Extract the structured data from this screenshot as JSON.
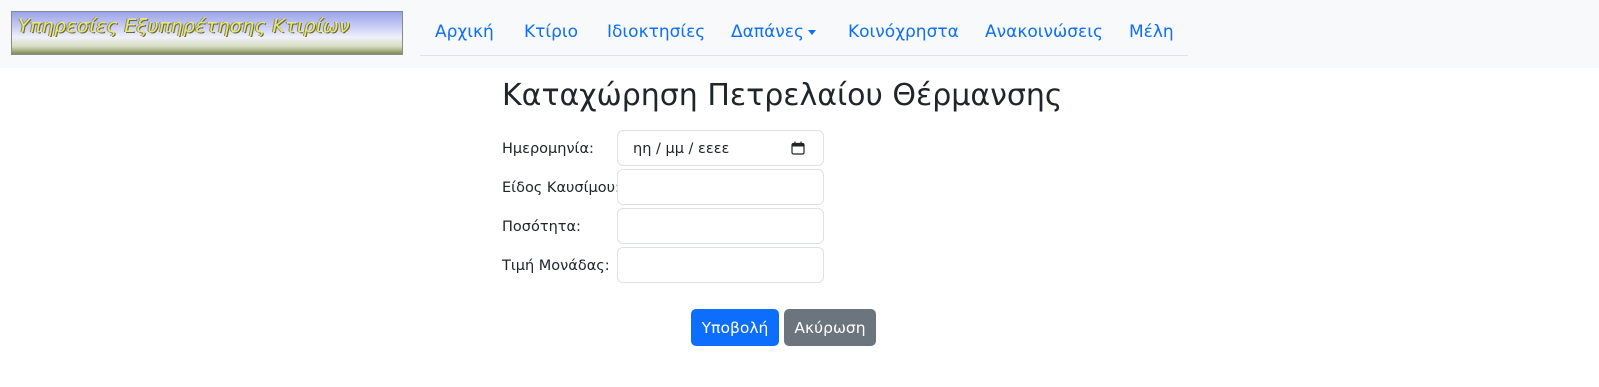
{
  "header": {
    "logo_text": "Υπηρεσίες Εξυπηρέτησης Κτιρίων",
    "nav": [
      {
        "label": "Αρχική"
      },
      {
        "label": "Κτίριο"
      },
      {
        "label": "Ιδιοκτησίες"
      },
      {
        "label": "Δαπάνες",
        "dropdown": true
      },
      {
        "label": "Κοινόχρηστα"
      },
      {
        "label": "Ανακοινώσεις"
      },
      {
        "label": "Μέλη"
      }
    ]
  },
  "form": {
    "title": "Καταχώρηση Πετρελαίου Θέρμανσης",
    "fields": [
      {
        "label": "Ημερομηνία:",
        "type": "date",
        "placeholder": "ηη / μμ / εεεε",
        "value": ""
      },
      {
        "label": "Είδος Καυσίμου:",
        "type": "text",
        "value": ""
      },
      {
        "label": "Ποσότητα:",
        "type": "text",
        "value": ""
      },
      {
        "label": "Τιμή Μονάδας:",
        "type": "text",
        "value": ""
      }
    ],
    "submit_label": "Υποβολή",
    "cancel_label": "Ακύρωση"
  },
  "colors": {
    "primary": "#0d6efd",
    "secondary": "#6c757d",
    "navbar_bg": "#f8f9fa"
  },
  "icons": {
    "date_picker": "calendar-icon",
    "dropdown": "caret-down-icon"
  }
}
